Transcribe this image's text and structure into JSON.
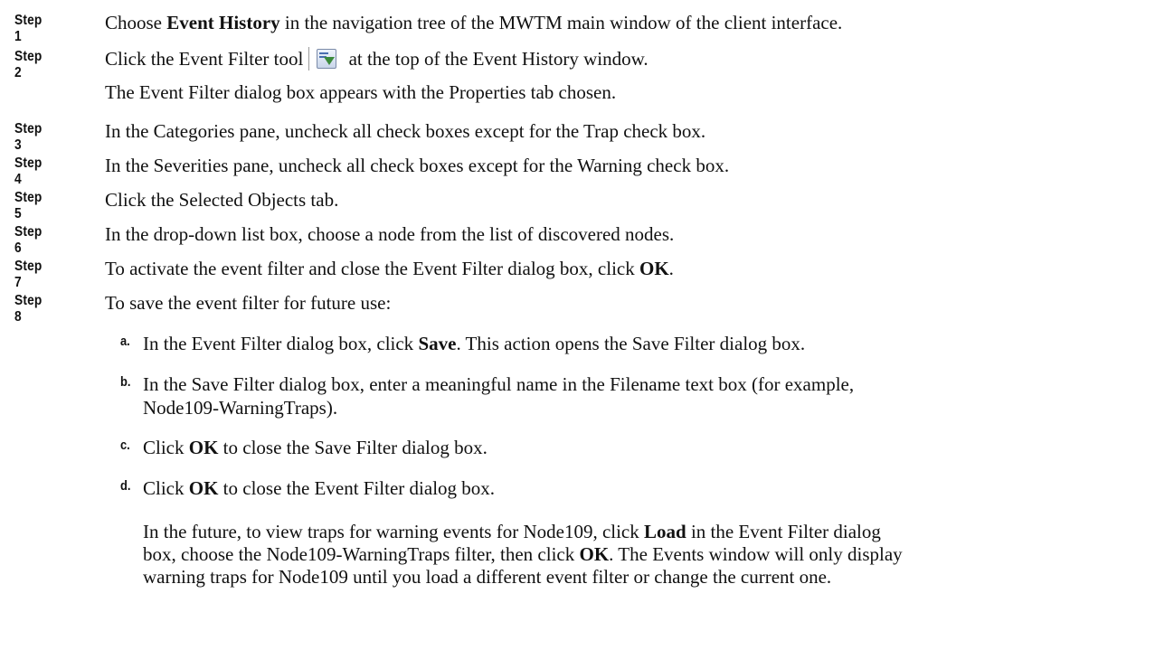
{
  "steps": [
    {
      "label": "Step 1",
      "pre": "Choose ",
      "bold": "Event History",
      "post": " in the navigation tree of the MWTM main window of the client interface."
    },
    {
      "label": "Step 2",
      "pre": "Click the Event Filter tool",
      "post": " at the top of the Event History window.",
      "note": "The Event Filter dialog box appears with the Properties tab chosen.",
      "icon": "event-filter-icon"
    },
    {
      "label": "Step 3",
      "text": "In the Categories pane, uncheck all check boxes except for the Trap check box."
    },
    {
      "label": "Step 4",
      "text": "In the Severities pane, uncheck all check boxes except for the Warning check box."
    },
    {
      "label": "Step 5",
      "text": "Click the Selected Objects tab."
    },
    {
      "label": "Step 6",
      "text": "In the drop-down list box, choose a node from the list of discovered nodes."
    },
    {
      "label": "Step 7",
      "pre": "To activate the event filter and close the Event Filter dialog box, click ",
      "bold": "OK",
      "post": "."
    },
    {
      "label": "Step 8",
      "text": "To save the event filter for future use:"
    }
  ],
  "substeps": [
    {
      "label": "a.",
      "pre": "In the Event Filter dialog box, click ",
      "bold": "Save",
      "post": ". This action opens the Save Filter dialog box."
    },
    {
      "label": "b.",
      "line1": "In the Save Filter dialog box, enter a meaningful name in the Filename text box (for example,",
      "line2": "Node109-WarningTraps)."
    },
    {
      "label": "c.",
      "pre": "Click ",
      "bold": "OK",
      "post": " to close the Save Filter dialog box."
    },
    {
      "label": "d.",
      "pre": "Click ",
      "bold": "OK",
      "post": " to close the Event Filter dialog box."
    }
  ],
  "final_note": {
    "l1_pre": "In the future, to view traps for warning events for Node109, click ",
    "l1_bold": "Load",
    "l1_post": " in the Event Filter dialog",
    "l2_pre": "box, choose the Node109-WarningTraps filter, then click ",
    "l2_bold": "OK",
    "l2_post": ". The Events window will only display",
    "l3": "warning traps for Node109 until you load a different event filter or change the current one."
  }
}
